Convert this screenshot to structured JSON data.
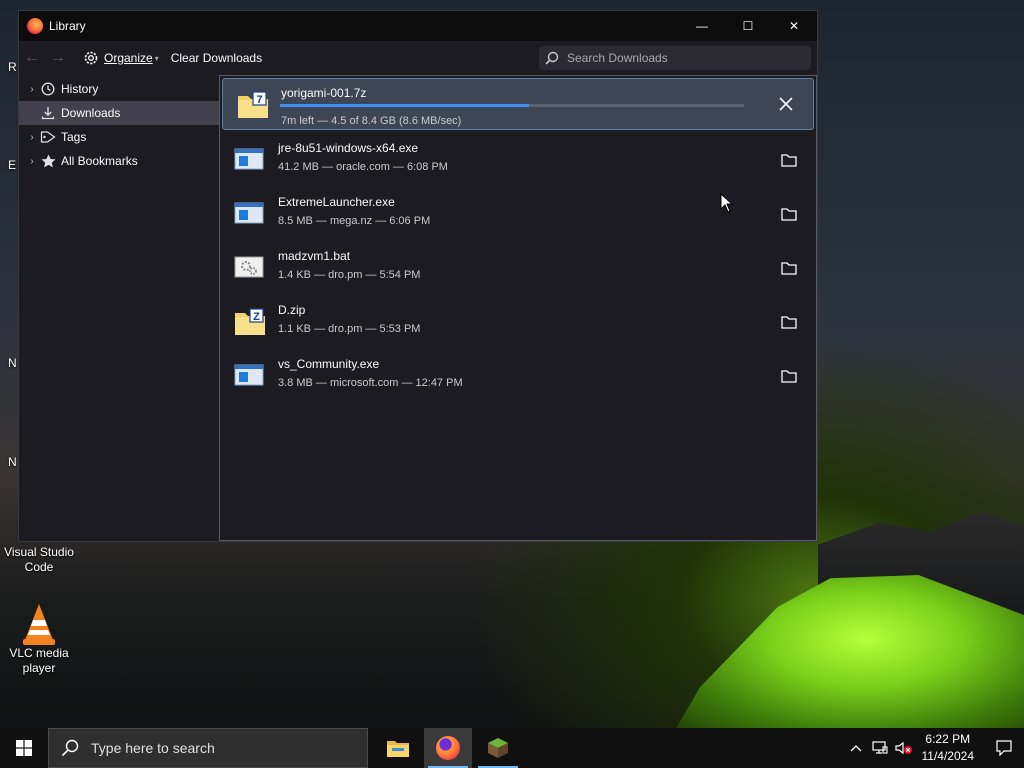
{
  "window": {
    "title": "Library",
    "minimize_glyph": "—",
    "maximize_glyph": "☐",
    "close_glyph": "✕"
  },
  "toolbar": {
    "back_glyph": "←",
    "forward_glyph": "→",
    "organize": "Organize",
    "clear": "Clear Downloads",
    "search_placeholder": "Search Downloads"
  },
  "sidebar": {
    "items": [
      {
        "label": "History",
        "icon": "clock-icon",
        "twisty": "›"
      },
      {
        "label": "Downloads",
        "icon": "download-icon",
        "selected": true
      },
      {
        "label": "Tags",
        "icon": "tag-icon",
        "twisty": "›"
      },
      {
        "label": "All Bookmarks",
        "icon": "star-icon",
        "twisty": "›"
      }
    ]
  },
  "downloads": {
    "active": {
      "name": "yorigami-001.7z",
      "status": "7m left — 4.5 of 8.4 GB (8.6 MB/sec)",
      "progress": 0.536,
      "icon": "archive-7z-icon"
    },
    "items": [
      {
        "name": "jre-8u51-windows-x64.exe",
        "status": "41.2 MB — oracle.com — 6:08 PM",
        "icon": "exe-icon"
      },
      {
        "name": "ExtremeLauncher.exe",
        "status": "8.5 MB — mega.nz — 6:06 PM",
        "icon": "exe-icon"
      },
      {
        "name": "madzvm1.bat",
        "status": "1.4 KB — dro.pm — 5:54 PM",
        "icon": "batch-file-icon"
      },
      {
        "name": "D.zip",
        "status": "1.1 KB — dro.pm — 5:53 PM",
        "icon": "zip-icon"
      },
      {
        "name": "vs_Community.exe",
        "status": "3.8 MB — microsoft.com — 12:47 PM",
        "icon": "exe-icon"
      }
    ]
  },
  "desktop": {
    "icons": [
      {
        "label": "Visual Studio Code"
      },
      {
        "label": "VLC media player"
      }
    ],
    "edge_fragments": [
      "R",
      "E",
      "N",
      "N"
    ]
  },
  "taskbar": {
    "search_placeholder": "Type here to search",
    "apps": [
      "file-explorer-icon",
      "firefox-icon",
      "minecraft-icon"
    ],
    "time": "6:22 PM",
    "date": "11/4/2024"
  },
  "colors": {
    "accent": "#3f8ff6",
    "window_bg": "#1c1b22",
    "selected": "#42414d"
  }
}
